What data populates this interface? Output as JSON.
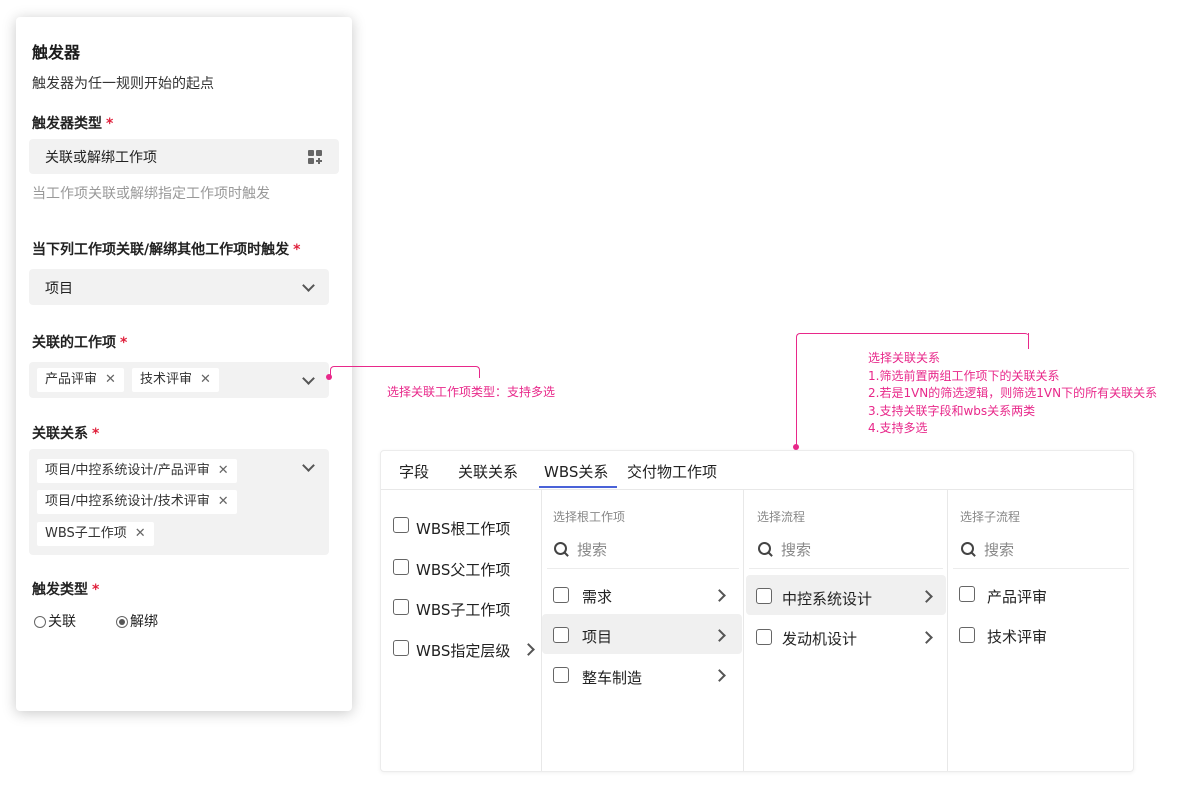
{
  "trigger_panel": {
    "title": "触发器",
    "description": "触发器为任一规则开始的起点",
    "trigger_type_label": "触发器类型",
    "trigger_type_value": "关联或解绑工作项",
    "trigger_type_icon": "grid-add-icon",
    "trigger_type_hint": "当工作项关联或解绑指定工作项时触发",
    "when_label": "当下列工作项关联/解绑其他工作项时触发",
    "when_value": "项目",
    "related_items_label": "关联的工作项",
    "related_items": [
      "产品评审",
      "技术评审"
    ],
    "relations_label": "关联关系",
    "relations": [
      "项目/中控系统设计/产品评审",
      "项目/中控系统设计/技术评审",
      "WBS子工作项"
    ],
    "trigger_kind_label": "触发类型",
    "trigger_kind_options": [
      "关联",
      "解绑"
    ],
    "trigger_kind_selected": "解绑",
    "required_mark": "*",
    "remove_glyph": "✕"
  },
  "annotations": {
    "left_note": "选择关联工作项类型：支持多选",
    "right_note": [
      "选择关联关系",
      "1.筛选前置两组工作项下的关联关系",
      "2.若是1VN的筛选逻辑，则筛选1VN下的所有关联关系",
      "3.支持关联字段和wbs关系两类",
      "4.支持多选"
    ],
    "color": "#e8288a"
  },
  "selector": {
    "tabs": [
      "字段",
      "关联关系",
      "WBS关系",
      "交付物工作项"
    ],
    "active_tab": "WBS关系",
    "accent": "#4a62d8",
    "wbs_options": [
      "WBS根工作项",
      "WBS父工作项",
      "WBS子工作项",
      "WBS指定层级"
    ],
    "root_col": {
      "title": "选择根工作项",
      "search_placeholder": "搜索",
      "items": [
        "需求",
        "项目",
        "整车制造"
      ]
    },
    "flow_col": {
      "title": "选择流程",
      "search_placeholder": "搜索",
      "items": [
        "中控系统设计",
        "发动机设计"
      ]
    },
    "subflow_col": {
      "title": "选择子流程",
      "search_placeholder": "搜索",
      "items": [
        "产品评审",
        "技术评审"
      ]
    }
  }
}
